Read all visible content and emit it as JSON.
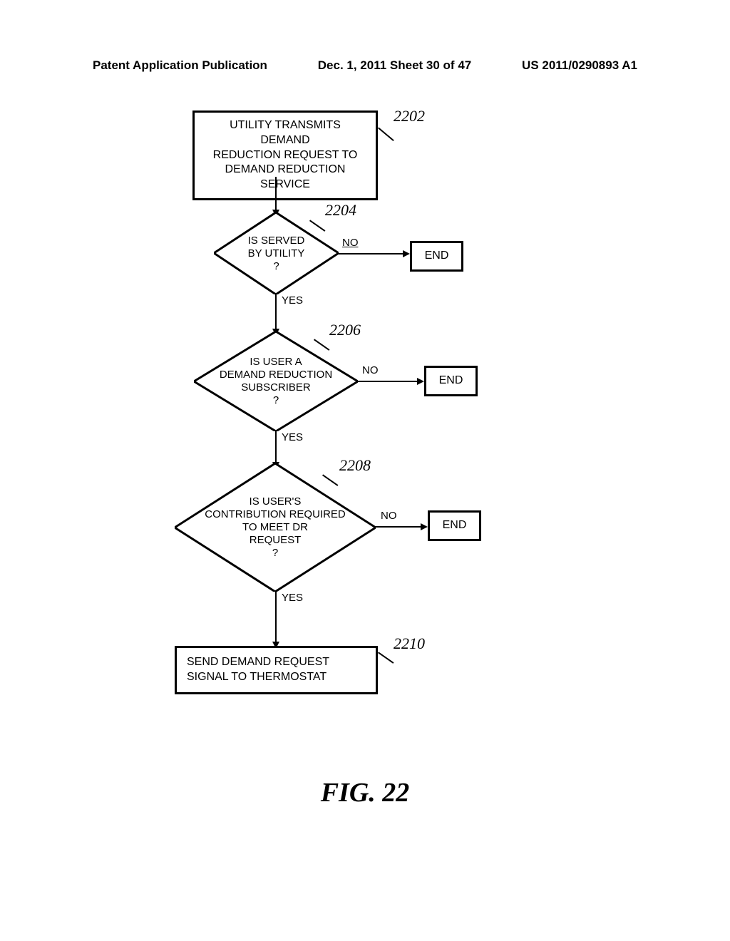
{
  "header": {
    "left": "Patent Application Publication",
    "center": "Dec. 1, 2011   Sheet 30 of 47",
    "right": "US 2011/0290893 A1"
  },
  "flowchart": {
    "start": "UTILITY TRANSMITS DEMAND\nREDUCTION REQUEST TO\nDEMAND REDUCTION\nSERVICE",
    "decision1": "IS SERVED\nBY UTILITY\n?",
    "decision2": "IS USER A\nDEMAND REDUCTION\nSUBSCRIBER\n?",
    "decision3": "IS USER'S\nCONTRIBUTION REQUIRED\nTO MEET DR\nREQUEST\n?",
    "final": "SEND DEMAND REQUEST\nSIGNAL TO THERMOSTAT",
    "end": "END",
    "yes": "YES",
    "no": "NO"
  },
  "refs": {
    "r1": "2202",
    "r2": "2204",
    "r3": "2206",
    "r4": "2208",
    "r5": "2210"
  },
  "figure": "FIG.  22"
}
